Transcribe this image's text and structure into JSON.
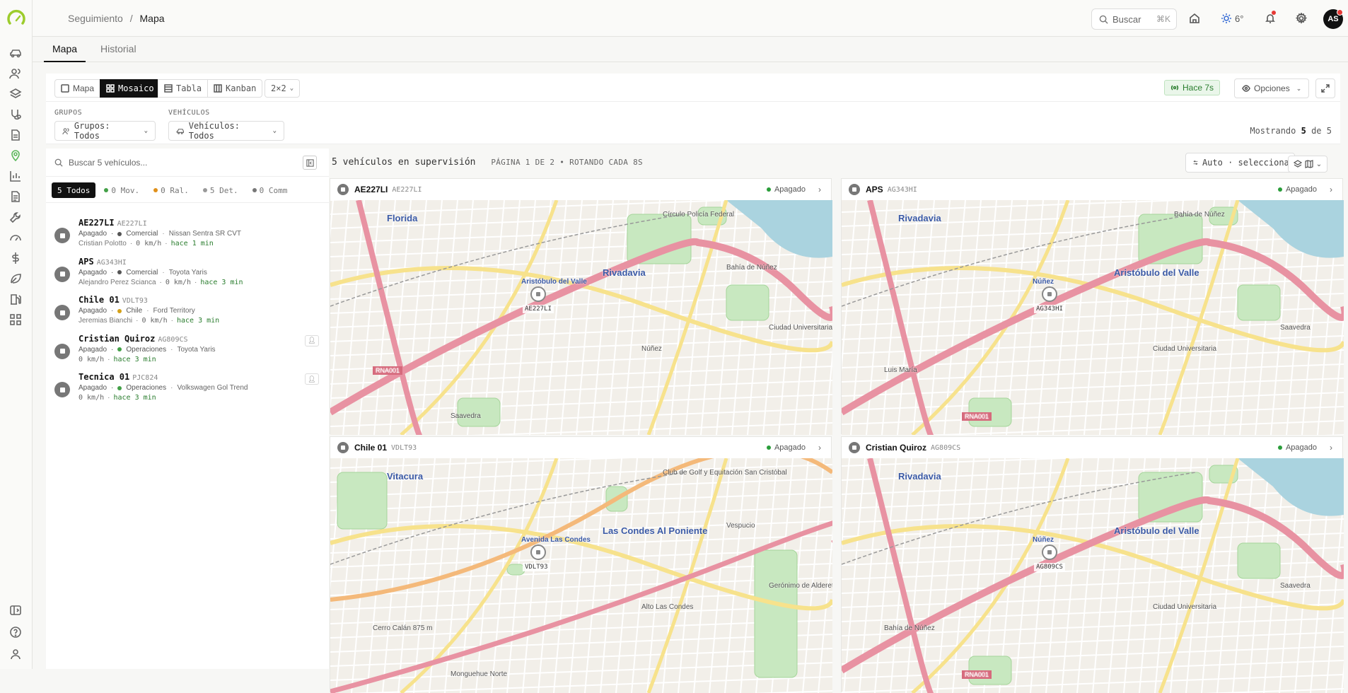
{
  "breadcrumb": {
    "parent": "Seguimiento",
    "sep": "/",
    "current": "Mapa"
  },
  "topbar": {
    "search_label": "Buscar",
    "search_kbd": "⌘K",
    "weather": "6°",
    "avatar": "AS"
  },
  "tabs": [
    {
      "label": "Mapa"
    },
    {
      "label": "Historial"
    }
  ],
  "views": {
    "mapa": "Mapa",
    "mosaico": "Mosaico",
    "tabla": "Tabla",
    "kanban": "Kanban",
    "grid": "2×2"
  },
  "status_toolbar": {
    "updated": "Hace 7s",
    "options": "Opciones"
  },
  "filters": {
    "groups_label": "GRUPOS",
    "groups_value": "Grupos: Todos",
    "vehicles_label": "VEHÍCULOS",
    "vehicles_value": "Vehículos: Todos",
    "showing_prefix": "Mostrando",
    "showing_count": "5",
    "showing_of": "de",
    "showing_total": "5"
  },
  "vehicle_panel": {
    "search_placeholder": "Buscar 5 vehículos...",
    "chips": [
      {
        "label": "5 Todos",
        "color": ""
      },
      {
        "label": "0 Mov.",
        "color": "#43a047"
      },
      {
        "label": "0 Ral.",
        "color": "#e0901a"
      },
      {
        "label": "5 Det.",
        "color": "#999999"
      },
      {
        "label": "0 Comm",
        "color": "#777777"
      }
    ],
    "vehicles": [
      {
        "name": "AE227LI",
        "plate": "AE227LI",
        "status": "Apagado",
        "group": "Comercial",
        "group_color": "#555555",
        "model": "Nissan Sentra SR CVT",
        "driver": "Cristian Polotto",
        "speed": "0 km/h",
        "ago": "hace 1 min"
      },
      {
        "name": "APS",
        "plate": "AG343HI",
        "status": "Apagado",
        "group": "Comercial",
        "group_color": "#555555",
        "model": "Toyota Yaris",
        "driver": "Alejandro Perez Scianca",
        "speed": "0 km/h",
        "ago": "hace 3 min"
      },
      {
        "name": "Chile 01",
        "plate": "VDLT93",
        "status": "Apagado",
        "group": "Chile",
        "group_color": "#d4a017",
        "model": "Ford Territory",
        "driver": "Jeremias Bianchi",
        "speed": "0 km/h",
        "ago": "hace 3 min"
      },
      {
        "name": "Cristian Quiroz",
        "plate": "AG809CS",
        "status": "Apagado",
        "group": "Operaciones",
        "group_color": "#43a047",
        "model": "Toyota Yaris",
        "driver": "",
        "speed": "0 km/h",
        "ago": "hace 3 min"
      },
      {
        "name": "Tecnica 01",
        "plate": "PJC824",
        "status": "Apagado",
        "group": "Operaciones",
        "group_color": "#43a047",
        "model": "Volkswagen Gol Trend",
        "driver": "",
        "speed": "0 km/h",
        "ago": "hace 3 min"
      }
    ]
  },
  "mosaic": {
    "summary": "5 vehículos en supervisión",
    "page_info": "PÁGINA 1 DE 2 • ROTANDO CADA 8S",
    "auto_label": "Auto · seleccionar",
    "tiles": [
      {
        "name": "AE227LI",
        "plate": "AE227LI",
        "status": "Apagado",
        "marker": "AE227LI",
        "labels": [
          "Florida",
          "Rivadavia",
          "Aristóbulo del Valle",
          "Núñez",
          "Ciudad Universitaria",
          "Saavedra",
          "RNA001",
          "Círculo Policía Federal",
          "Bahía de Núñez"
        ]
      },
      {
        "name": "APS",
        "plate": "AG343HI",
        "status": "Apagado",
        "marker": "AG343HI",
        "labels": [
          "Rivadavia",
          "Aristóbulo del Valle",
          "Núñez",
          "Ciudad Universitaria",
          "Saavedra",
          "RNA001",
          "Luis María",
          "Bahía de Núñez"
        ]
      },
      {
        "name": "Chile 01",
        "plate": "VDLT93",
        "status": "Apagado",
        "marker": "VDLT93",
        "labels": [
          "Vitacura",
          "Las Condes Al Poniente",
          "Avenida Las Condes",
          "Alto Las Condes",
          "Gerónimo de Alderete",
          "Monguehue Norte",
          "Cerro Calán 875 m",
          "Club de Golf y Equitación San Cristóbal",
          "Vespucio"
        ]
      },
      {
        "name": "Cristian Quiroz",
        "plate": "AG809CS",
        "status": "Apagado",
        "marker": "AG809CS",
        "labels": [
          "Rivadavia",
          "Aristóbulo del Valle",
          "Núñez",
          "Ciudad Universitaria",
          "Saavedra",
          "RNA001",
          "Bahía de Núñez"
        ]
      }
    ]
  },
  "colors": {
    "accent": "#5cb85c",
    "status_green": "#2a9d3a",
    "water": "#aad3df",
    "park": "#c8e8c0",
    "highway": "#e892a2"
  }
}
